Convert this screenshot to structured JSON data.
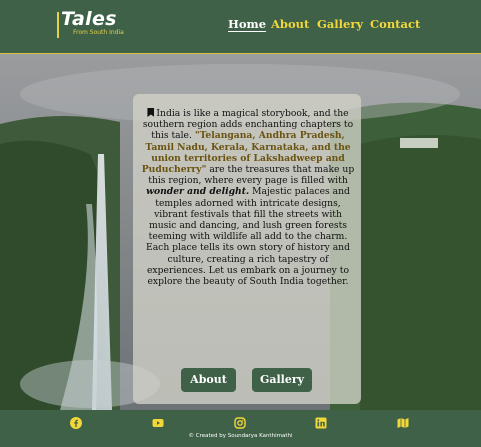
{
  "logo": {
    "title": "Tales",
    "subtitle": "From South India"
  },
  "nav": {
    "home": "Home",
    "about": "About",
    "gallery": "Gallery",
    "contact": "Contact"
  },
  "card": {
    "intro": "India is like a magical storybook, and the southern region adds enchanting chapters to this tale.",
    "highlight": "\"Telangana, Andhra Pradesh, Tamil Nadu, Kerala, Karnataka, and the union territories of Lakshadweep and Puducherry\"",
    "mid": "are the treasures that make up this region, where every page is filled with",
    "emphasis": "wonder and delight.",
    "body": "Majestic palaces and temples adorned with intricate designs, vibrant festivals that fill the streets with music and dancing, and lush green forests teeming with wildlife all add to the charm. Each place tells its own story of history and culture, creating a rich tapestry of experiences. Let us embark on a journey to explore the beauty of South India together."
  },
  "buttons": {
    "about": "About",
    "gallery": "Gallery"
  },
  "footer": {
    "credit": "© Created by Soundarya Kanthimathi"
  },
  "colors": {
    "green": "#3f6148",
    "gold": "#f2d73a",
    "highlight": "#6b5310"
  },
  "icons": [
    "bookmark-icon",
    "facebook-icon",
    "youtube-icon",
    "instagram-icon",
    "linkedin-icon",
    "map-icon"
  ]
}
